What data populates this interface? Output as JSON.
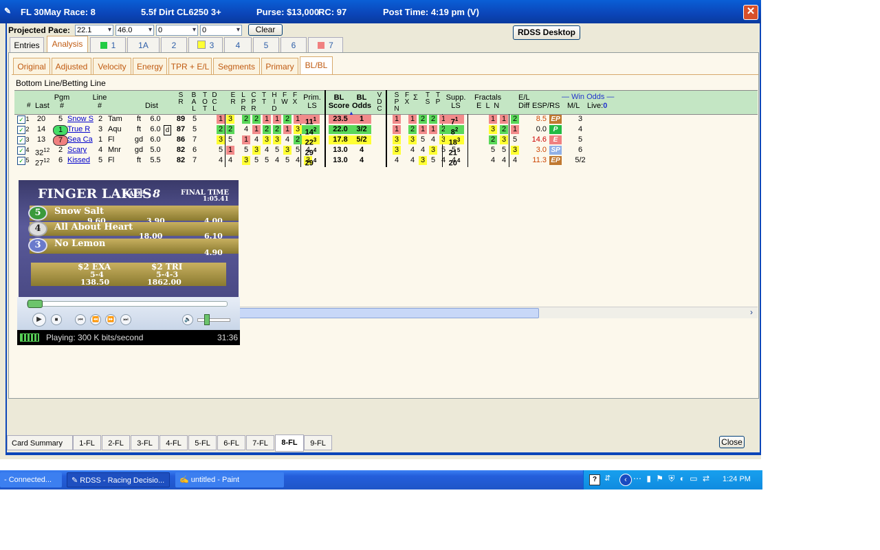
{
  "title_bar": {
    "race": "FL 30May Race: 8",
    "conditions": "5.5f  Dirt   CL6250  3+",
    "purse": "Purse: $13,000",
    "rc": "RC: 97",
    "post_time": "Post Time: 4:19 pm  (V)"
  },
  "pace": {
    "label": "Projected Pace:",
    "values": [
      "22.1",
      "46.0",
      "0",
      "0"
    ],
    "clear_label": "Clear",
    "desktop_label": "RDSS Desktop"
  },
  "main_tabs": [
    "Entries",
    "Analysis"
  ],
  "horse_tabs": [
    {
      "label": "1",
      "swatch": "#22cc44"
    },
    {
      "label": "1A",
      "swatch": ""
    },
    {
      "label": "2",
      "swatch": ""
    },
    {
      "label": "3",
      "swatch": "#ffff33"
    },
    {
      "label": "4",
      "swatch": ""
    },
    {
      "label": "5",
      "swatch": ""
    },
    {
      "label": "6",
      "swatch": ""
    },
    {
      "label": "7",
      "swatch": "#f08080"
    }
  ],
  "sub_tabs": [
    "Original",
    "Adjusted",
    "Velocity",
    "Energy",
    "TPR + E/L",
    "Segments",
    "Primary",
    "BL/BL"
  ],
  "section_title": "Bottom Line/Betting Line",
  "headers": {
    "num": "#",
    "last": "Last",
    "pgm": "Pgm\n#",
    "line": "Line\n#",
    "dist": "Dist",
    "sr": "S\nR",
    "bal": "B\nA\nL",
    "toot": "T\nO\nT",
    "dcl": "D\nC\nL",
    "er": "E\nR",
    "lpr": "L\nP\nR",
    "cpr": "C\nP\nR",
    "tt": "T\nT",
    "hid": "H\nI\nD",
    "fw": "F\nW",
    "fx": "F\nX",
    "prim": "Prim.\nLS",
    "bl_score": "BL\nScore",
    "bl_odds": "BL\nOdds",
    "vdc": "V\nD\nC",
    "spn": "S\nP\nN",
    "fx2": "F\nX",
    "sigma": "Σ",
    "ts": "T\nS",
    "tp": "T\nP",
    "supp": "Supp.\nLS",
    "fractals": "Fractals",
    "eln": "E  L  N",
    "el": "E/L",
    "diff": "Diff",
    "esp": "ESP/RS",
    "win_odds": "Win Odds",
    "ml": "M/L",
    "live": "Live:",
    "live_val": "0"
  },
  "rows": [
    {
      "chk": "1",
      "last": "20",
      "last_sup": "",
      "pgm": "5",
      "pgm_badge": "",
      "name": "Snow S",
      "line": "2",
      "trk": "Tam",
      "cond": "ft",
      "dist": "6.0",
      "d_flag": "",
      "sr": "89",
      "bal": "5",
      "tot": {
        "v": "1",
        "c": "r"
      },
      "dcl": {
        "v": "3",
        "c": "y"
      },
      "er": {
        "v": "2",
        "c": "g"
      },
      "lpr": {
        "v": "2",
        "c": "g"
      },
      "cpr": {
        "v": "1",
        "c": "r"
      },
      "tt": {
        "v": "1",
        "c": "r"
      },
      "hid": {
        "v": "2",
        "c": "g"
      },
      "fw": {
        "v": "1",
        "c": "r"
      },
      "fx": {
        "v": "2",
        "c": "g"
      },
      "prim": {
        "v": "11",
        "sup": "1",
        "c": "r"
      },
      "score": {
        "v": "23.5",
        "c": "r"
      },
      "odds": {
        "v": "1",
        "c": "r"
      },
      "vdc": {
        "v": "1",
        "c": "r"
      },
      "spn": {
        "v": "1",
        "c": "r"
      },
      "fx2": {
        "v": "2",
        "c": "g"
      },
      "sig": {
        "v": "2",
        "c": "g"
      },
      "ts": {
        "v": "1",
        "c": "r"
      },
      "tp": {
        "v": "1",
        "c": "r"
      },
      "supp": {
        "v": "7",
        "sup": "1",
        "c": "r"
      },
      "fe": {
        "v": "1",
        "c": "r"
      },
      "fl": {
        "v": "1",
        "c": "r"
      },
      "fn": {
        "v": "2",
        "c": "g"
      },
      "diff": "8.5",
      "diff_color": "#cc4400",
      "esp": "EP",
      "esp_bg": "#c07830",
      "ml": "3"
    },
    {
      "chk": "2",
      "last": "14",
      "last_sup": "",
      "pgm": "1",
      "pgm_badge": "#44dd66",
      "name": "True R",
      "line": "3",
      "trk": "Aqu",
      "cond": "ft",
      "dist": "6.0",
      "d_flag": "d",
      "sr": "87",
      "bal": "5",
      "tot": {
        "v": "2",
        "c": "g"
      },
      "dcl": {
        "v": "2",
        "c": "g"
      },
      "er": {
        "v": "4",
        "c": ""
      },
      "lpr": {
        "v": "1",
        "c": "r"
      },
      "cpr": {
        "v": "2",
        "c": "g"
      },
      "tt": {
        "v": "2",
        "c": "g"
      },
      "hid": {
        "v": "1",
        "c": "r"
      },
      "fw": {
        "v": "3",
        "c": "y"
      },
      "fx": {
        "v": "1",
        "c": "r"
      },
      "prim": {
        "v": "14",
        "sup": "2",
        "c": "g"
      },
      "score": {
        "v": "22.0",
        "c": "g"
      },
      "odds": {
        "v": "3/2",
        "c": "g"
      },
      "vdc": {
        "v": "1",
        "c": "r"
      },
      "spn": {
        "v": "2",
        "c": "g"
      },
      "fx2": {
        "v": "1",
        "c": "r"
      },
      "sig": {
        "v": "1",
        "c": "r"
      },
      "ts": {
        "v": "2",
        "c": "g"
      },
      "tp": {
        "v": "2",
        "c": "g"
      },
      "supp": {
        "v": "8",
        "sup": "2",
        "c": "g"
      },
      "fe": {
        "v": "3",
        "c": "y"
      },
      "fl": {
        "v": "2",
        "c": "g"
      },
      "fn": {
        "v": "1",
        "c": "r"
      },
      "diff": "0.0",
      "diff_color": "#000000",
      "esp": "P",
      "esp_bg": "#22bb44",
      "ml": "4"
    },
    {
      "chk": "3",
      "last": "13",
      "last_sup": "",
      "pgm": "7",
      "pgm_badge": "#f08080",
      "name": "Sea Ca",
      "line": "1",
      "trk": "Fl",
      "cond": "gd",
      "dist": "6.0",
      "d_flag": "",
      "sr": "86",
      "bal": "7",
      "tot": {
        "v": "3",
        "c": "y"
      },
      "dcl": {
        "v": "5",
        "c": ""
      },
      "er": {
        "v": "1",
        "c": "r"
      },
      "lpr": {
        "v": "4",
        "c": ""
      },
      "cpr": {
        "v": "3",
        "c": "y"
      },
      "tt": {
        "v": "3",
        "c": "y"
      },
      "hid": {
        "v": "4",
        "c": ""
      },
      "fw": {
        "v": "2",
        "c": "g"
      },
      "fx": {
        "v": "5",
        "c": ""
      },
      "prim": {
        "v": "22",
        "sup": "3",
        "c": "y"
      },
      "score": {
        "v": "17.8",
        "c": "y"
      },
      "odds": {
        "v": "5/2",
        "c": "y"
      },
      "vdc": {
        "v": "3",
        "c": "y"
      },
      "spn": {
        "v": "3",
        "c": "y"
      },
      "fx2": {
        "v": "5",
        "c": ""
      },
      "sig": {
        "v": "4",
        "c": ""
      },
      "ts": {
        "v": "3",
        "c": "y"
      },
      "tp": {
        "v": "3",
        "c": "y"
      },
      "supp": {
        "v": "18",
        "sup": "3",
        "c": "y"
      },
      "fe": {
        "v": "2",
        "c": "g"
      },
      "fl": {
        "v": "3",
        "c": "y"
      },
      "fn": {
        "v": "5",
        "c": ""
      },
      "diff": "14.6",
      "diff_color": "#cc0000",
      "esp": "E",
      "esp_bg": "#f08080",
      "ml": "5"
    },
    {
      "chk": "4",
      "last": "32",
      "last_sup": "12",
      "pgm": "2",
      "pgm_badge": "",
      "name": "Scary",
      "line": "4",
      "trk": "Mnr",
      "cond": "gd",
      "dist": "5.0",
      "d_flag": "",
      "sr": "82",
      "bal": "6",
      "tot": {
        "v": "5",
        "c": ""
      },
      "dcl": {
        "v": "1",
        "c": "r"
      },
      "er": {
        "v": "5",
        "c": ""
      },
      "lpr": {
        "v": "3",
        "c": "y"
      },
      "cpr": {
        "v": "4",
        "c": ""
      },
      "tt": {
        "v": "5",
        "c": ""
      },
      "hid": {
        "v": "3",
        "c": "y"
      },
      "fw": {
        "v": "5",
        "c": ""
      },
      "fx": {
        "v": "4",
        "c": ""
      },
      "prim": {
        "v": "29",
        "sup": "4",
        "c": ""
      },
      "score": {
        "v": "13.0",
        "c": ""
      },
      "odds": {
        "v": "4",
        "c": ""
      },
      "vdc": {
        "v": "3",
        "c": "y"
      },
      "spn": {
        "v": "4",
        "c": ""
      },
      "fx2": {
        "v": "4",
        "c": ""
      },
      "sig": {
        "v": "3",
        "c": "y"
      },
      "ts": {
        "v": "5",
        "c": ""
      },
      "tp": {
        "v": "5",
        "c": ""
      },
      "supp": {
        "v": "21",
        "sup": "5",
        "c": ""
      },
      "fe": {
        "v": "5",
        "c": ""
      },
      "fl": {
        "v": "5",
        "c": ""
      },
      "fn": {
        "v": "3",
        "c": "y"
      },
      "diff": "3.0",
      "diff_color": "#cc4400",
      "esp": "SP",
      "esp_bg": "#8fb0e8",
      "ml": "6"
    },
    {
      "chk": "5",
      "last": "27",
      "last_sup": "12",
      "pgm": "6",
      "pgm_badge": "",
      "name": "Kissed",
      "line": "5",
      "trk": "Fl",
      "cond": "ft",
      "dist": "5.5",
      "d_flag": "",
      "sr": "82",
      "bal": "7",
      "tot": {
        "v": "4",
        "c": ""
      },
      "dcl": {
        "v": "4",
        "c": ""
      },
      "er": {
        "v": "3",
        "c": "y"
      },
      "lpr": {
        "v": "5",
        "c": ""
      },
      "cpr": {
        "v": "5",
        "c": ""
      },
      "tt": {
        "v": "4",
        "c": ""
      },
      "hid": {
        "v": "5",
        "c": ""
      },
      "fw": {
        "v": "4",
        "c": ""
      },
      "fx": {
        "v": "3",
        "c": "y"
      },
      "prim": {
        "v": "29",
        "sup": "4",
        "c": ""
      },
      "score": {
        "v": "13.0",
        "c": ""
      },
      "odds": {
        "v": "4",
        "c": ""
      },
      "vdc": {
        "v": "4",
        "c": ""
      },
      "spn": {
        "v": "4",
        "c": ""
      },
      "fx2": {
        "v": "3",
        "c": "y"
      },
      "sig": {
        "v": "5",
        "c": ""
      },
      "ts": {
        "v": "4",
        "c": ""
      },
      "tp": {
        "v": "4",
        "c": ""
      },
      "supp": {
        "v": "20",
        "sup": "4",
        "c": ""
      },
      "fe": {
        "v": "4",
        "c": ""
      },
      "fl": {
        "v": "4",
        "c": ""
      },
      "fn": {
        "v": "4",
        "c": ""
      },
      "diff": "11.3",
      "diff_color": "#cc4400",
      "esp": "EP",
      "esp_bg": "#c07830",
      "ml": "5/2"
    }
  ],
  "video": {
    "track": "FINGER LAKES",
    "race": "RACE",
    "race_num": "8",
    "final_time_label": "FINAL TIME",
    "final_time": "1:05.41",
    "results": [
      {
        "pos": "5",
        "name": "Snow Salt",
        "win": "9.60",
        "place": "3.90",
        "show": "4.00"
      },
      {
        "pos": "4",
        "name": "All About Heart",
        "win": "",
        "place": "18.00",
        "show": "6.10"
      },
      {
        "pos": "3",
        "name": "No Lemon",
        "win": "",
        "place": "",
        "show": "4.90"
      }
    ],
    "exotics": [
      {
        "label": "$2 EXA",
        "combo": "5-4",
        "pays": "138.50"
      },
      {
        "label": "$2 TRI",
        "combo": "5-4-3",
        "pays": "1862.00"
      }
    ]
  },
  "player": {
    "status": "Playing: 300 K bits/second",
    "time": "31:36"
  },
  "bottom_tabs": [
    "Card Summary",
    "1-FL",
    "2-FL",
    "3-FL",
    "4-FL",
    "5-FL",
    "6-FL",
    "7-FL",
    "8-FL",
    "9-FL"
  ],
  "close_label": "Close",
  "taskbar": {
    "items": [
      "- Connected...",
      "RDSS - Racing Decisio...",
      "untitled - Paint"
    ],
    "clock": "1:24 PM"
  }
}
